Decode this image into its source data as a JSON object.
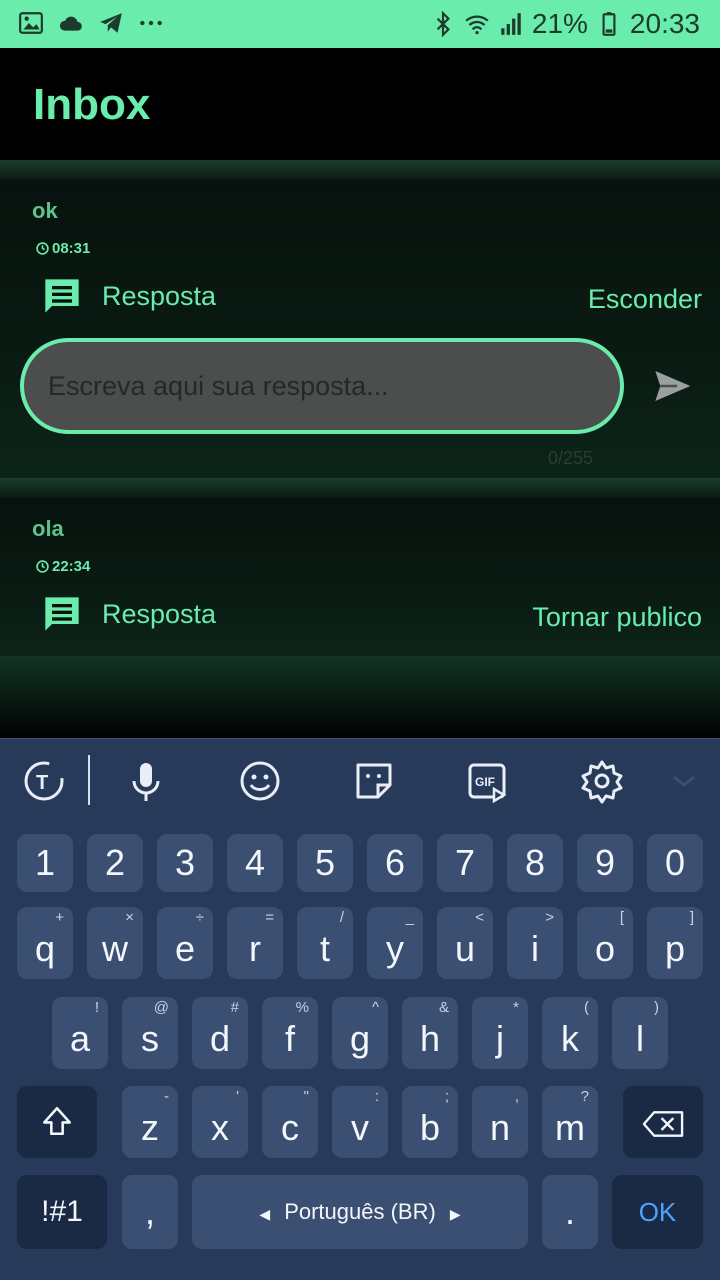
{
  "status": {
    "battery": "21%",
    "time": "20:33"
  },
  "app": {
    "title": "Inbox"
  },
  "messages": [
    {
      "text": "ok",
      "time": "08:31",
      "reply_label": "Resposta",
      "action_label": "Esconder"
    },
    {
      "text": "ola",
      "time": "22:34",
      "reply_label": "Resposta",
      "action_label": "Tornar publico"
    }
  ],
  "reply_input": {
    "placeholder": "Escreva aqui sua resposta...",
    "counter": "0/255"
  },
  "keyboard": {
    "row1": [
      "1",
      "2",
      "3",
      "4",
      "5",
      "6",
      "7",
      "8",
      "9",
      "0"
    ],
    "row2": [
      {
        "k": "q",
        "s": "+"
      },
      {
        "k": "w",
        "s": "×"
      },
      {
        "k": "e",
        "s": "÷"
      },
      {
        "k": "r",
        "s": "="
      },
      {
        "k": "t",
        "s": "/"
      },
      {
        "k": "y",
        "s": "_"
      },
      {
        "k": "u",
        "s": "<"
      },
      {
        "k": "i",
        "s": ">"
      },
      {
        "k": "o",
        "s": "["
      },
      {
        "k": "p",
        "s": "]"
      }
    ],
    "row3": [
      {
        "k": "a",
        "s": "!"
      },
      {
        "k": "s",
        "s": "@"
      },
      {
        "k": "d",
        "s": "#"
      },
      {
        "k": "f",
        "s": "%"
      },
      {
        "k": "g",
        "s": "^"
      },
      {
        "k": "h",
        "s": "&"
      },
      {
        "k": "j",
        "s": "*"
      },
      {
        "k": "k",
        "s": "("
      },
      {
        "k": "l",
        "s": ")"
      }
    ],
    "row4": [
      {
        "k": "z",
        "s": "-"
      },
      {
        "k": "x",
        "s": "'"
      },
      {
        "k": "c",
        "s": "\""
      },
      {
        "k": "v",
        "s": ":"
      },
      {
        "k": "b",
        "s": ";"
      },
      {
        "k": "n",
        "s": ","
      },
      {
        "k": "m",
        "s": "?"
      }
    ],
    "symbols_label": "!#1",
    "comma": ",",
    "language": "Português (BR)",
    "period": ".",
    "ok_label": "OK"
  },
  "colors": {
    "accent": "#69ecac",
    "keyboard_bg": "#283a59",
    "key_bg": "#3b4f72"
  }
}
